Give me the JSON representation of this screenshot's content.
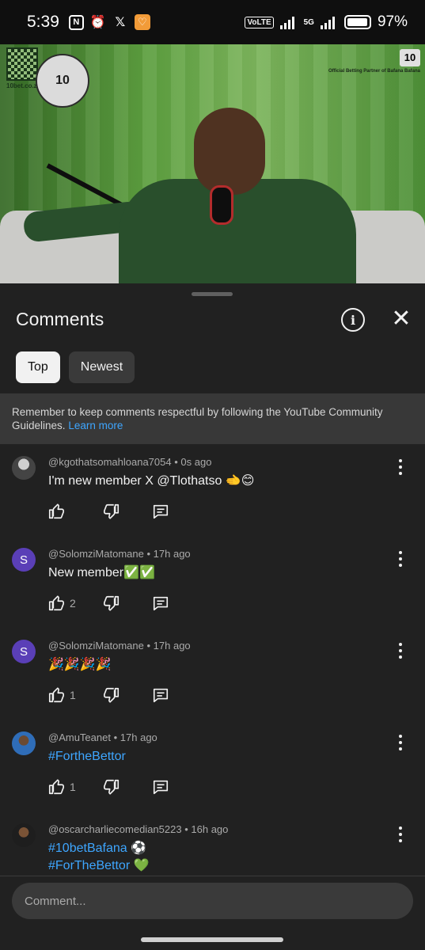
{
  "status_bar": {
    "time": "5:39",
    "left_icons": [
      "nfc-icon",
      "alarm-icon",
      "x-icon",
      "app-notification-icon"
    ],
    "volte": "VoLTE",
    "network": "5G",
    "battery_percent": "97%",
    "battery_level": 0.97
  },
  "video": {
    "qr_label": "10bet.co.za",
    "brand_logo": "10",
    "brand_text": "Official Betting Partner of Bafana Bafana",
    "ball_logo": "10"
  },
  "sheet": {
    "title": "Comments",
    "info_icon": "info-icon",
    "close_icon": "close-icon",
    "chips": [
      {
        "label": "Top",
        "active": true
      },
      {
        "label": "Newest",
        "active": false
      }
    ],
    "notice_text": "Remember to keep comments respectful by following the YouTube Community Guidelines.",
    "notice_link": "Learn more"
  },
  "comments": [
    {
      "author": "@kgothatsomahloana7054",
      "time": "0s ago",
      "text": "I'm new member X @Tlothatso 🫲😊",
      "likes": "",
      "avatar": "photo",
      "avatar_letter": ""
    },
    {
      "author": "@SolomziMatomane",
      "time": "17h ago",
      "text": "New member✅✅",
      "likes": "2",
      "avatar": "letter",
      "avatar_letter": "S"
    },
    {
      "author": "@SolomziMatomane",
      "time": "17h ago",
      "text": "🎉🎉🎉🎉",
      "likes": "1",
      "avatar": "letter",
      "avatar_letter": "S"
    },
    {
      "author": "@AmuTeanet",
      "time": "17h ago",
      "text": "#FortheBettor",
      "likes": "1",
      "avatar": "photo",
      "avatar_letter": ""
    },
    {
      "author": "@oscarcharliecomedian5223",
      "time": "16h ago",
      "text_line1": "#10betBafana ⚽",
      "text_line2": "#ForTheBettor 💚",
      "likes": "",
      "avatar": "photo",
      "avatar_letter": ""
    }
  ],
  "meta_separator": "•",
  "composer": {
    "placeholder": "Comment..."
  }
}
